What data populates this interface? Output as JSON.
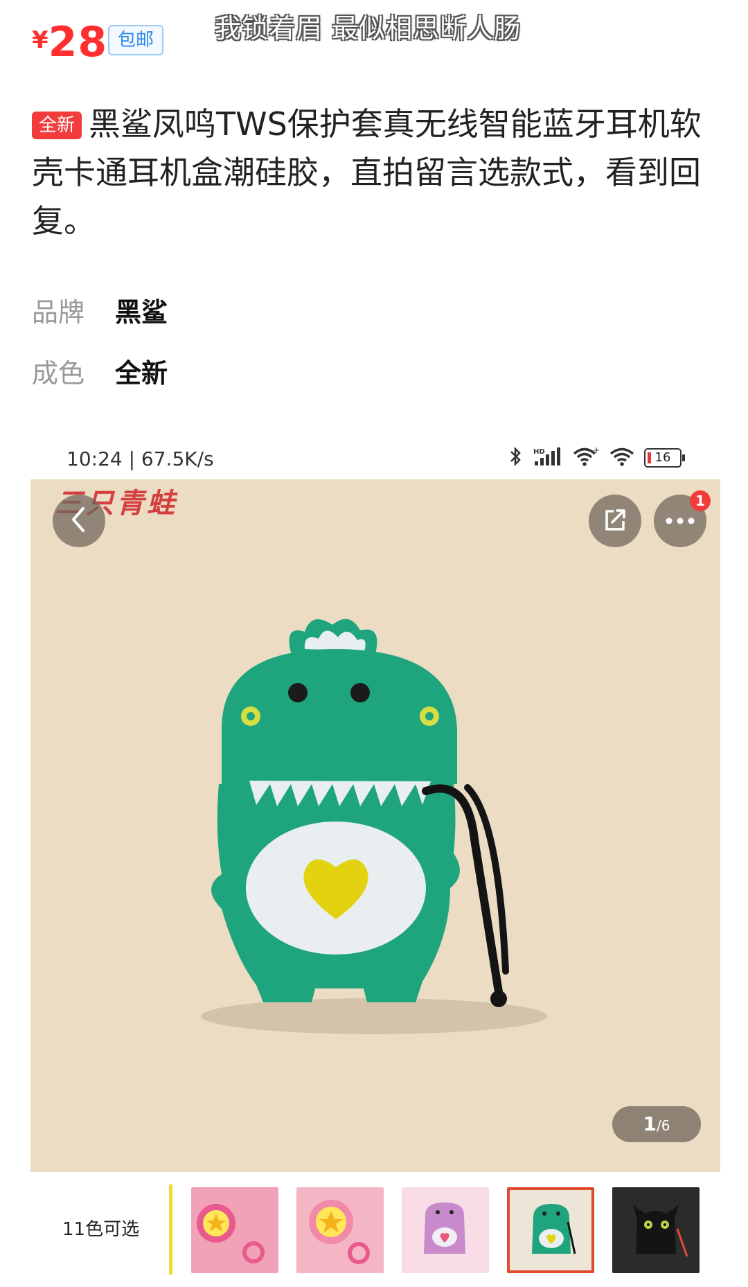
{
  "overlay_caption": "我锁着眉 最似相思断人肠",
  "listing": {
    "currency_symbol": "¥",
    "price": "28",
    "shipping_badge": "包邮",
    "condition_badge": "全新",
    "title": "黑鲨凤鸣TWS保护套真无线智能蓝牙耳机软壳卡通耳机盒潮硅胶，直拍留言选款式，看到回复。",
    "attributes": [
      {
        "key": "品牌",
        "value": "黑鲨"
      },
      {
        "key": "成色",
        "value": "全新"
      }
    ]
  },
  "embedded_screenshot": {
    "statusbar": {
      "time_speed": "10:24 | 67.5K/s",
      "battery": "16",
      "icons": [
        "bluetooth-icon",
        "hd-signal-icon",
        "wifi-plus-icon",
        "wifi-icon",
        "battery-icon"
      ]
    },
    "watermark": "三只青蛙",
    "more_badge_count": "1",
    "pager": {
      "current": "1",
      "total": "/6"
    },
    "variants_label": "11色可选",
    "colors": {
      "photo_bg": "#ecdcc3",
      "dino_green": "#1fa57d",
      "accent_red": "#f23c3c"
    }
  }
}
